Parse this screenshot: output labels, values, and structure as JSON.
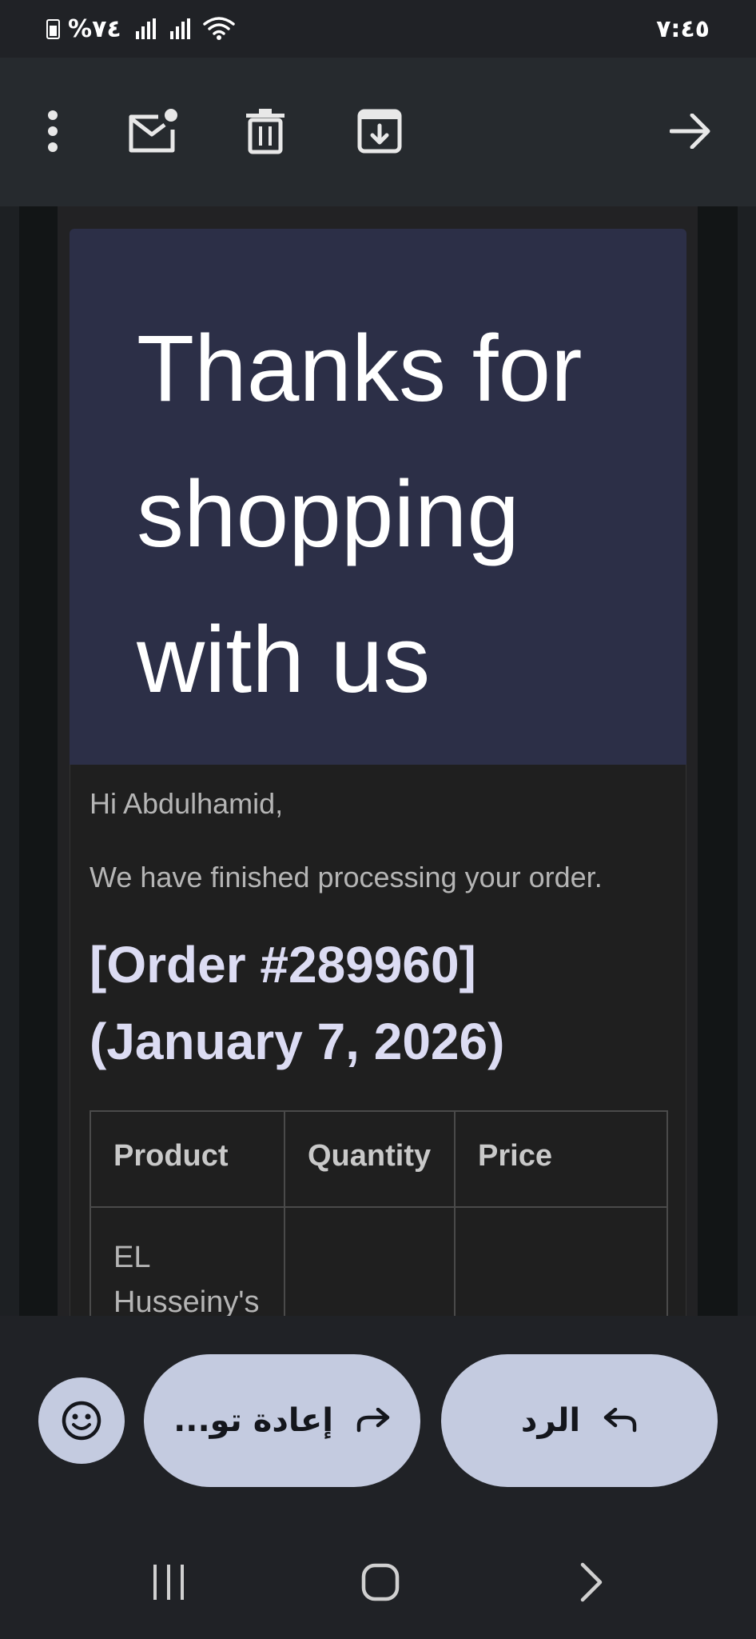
{
  "status_bar": {
    "battery_percent": "%٧٤",
    "time": "٧:٤٥"
  },
  "toolbar": {
    "icons": [
      "more-vert-icon",
      "mark-unread-icon",
      "delete-icon",
      "archive-icon",
      "forward-arrow-icon"
    ]
  },
  "email": {
    "hero_title": "Thanks for shopping with us",
    "greeting": "Hi Abdulhamid,",
    "message": "We have finished processing your order.",
    "order_heading": "[Order #289960] (January 7, 2026)",
    "table": {
      "headers": [
        "Product",
        "Quantity",
        "Price"
      ],
      "rows": [
        [
          "EL Husseiny's",
          "",
          ""
        ]
      ]
    }
  },
  "actions": {
    "forward_label": "إعادة تو...",
    "reply_label": "الرد"
  },
  "colors": {
    "accent_pill": "#c4cbe0",
    "hero_bg": "#2c2f47",
    "order_heading": "#dcdcf3"
  }
}
